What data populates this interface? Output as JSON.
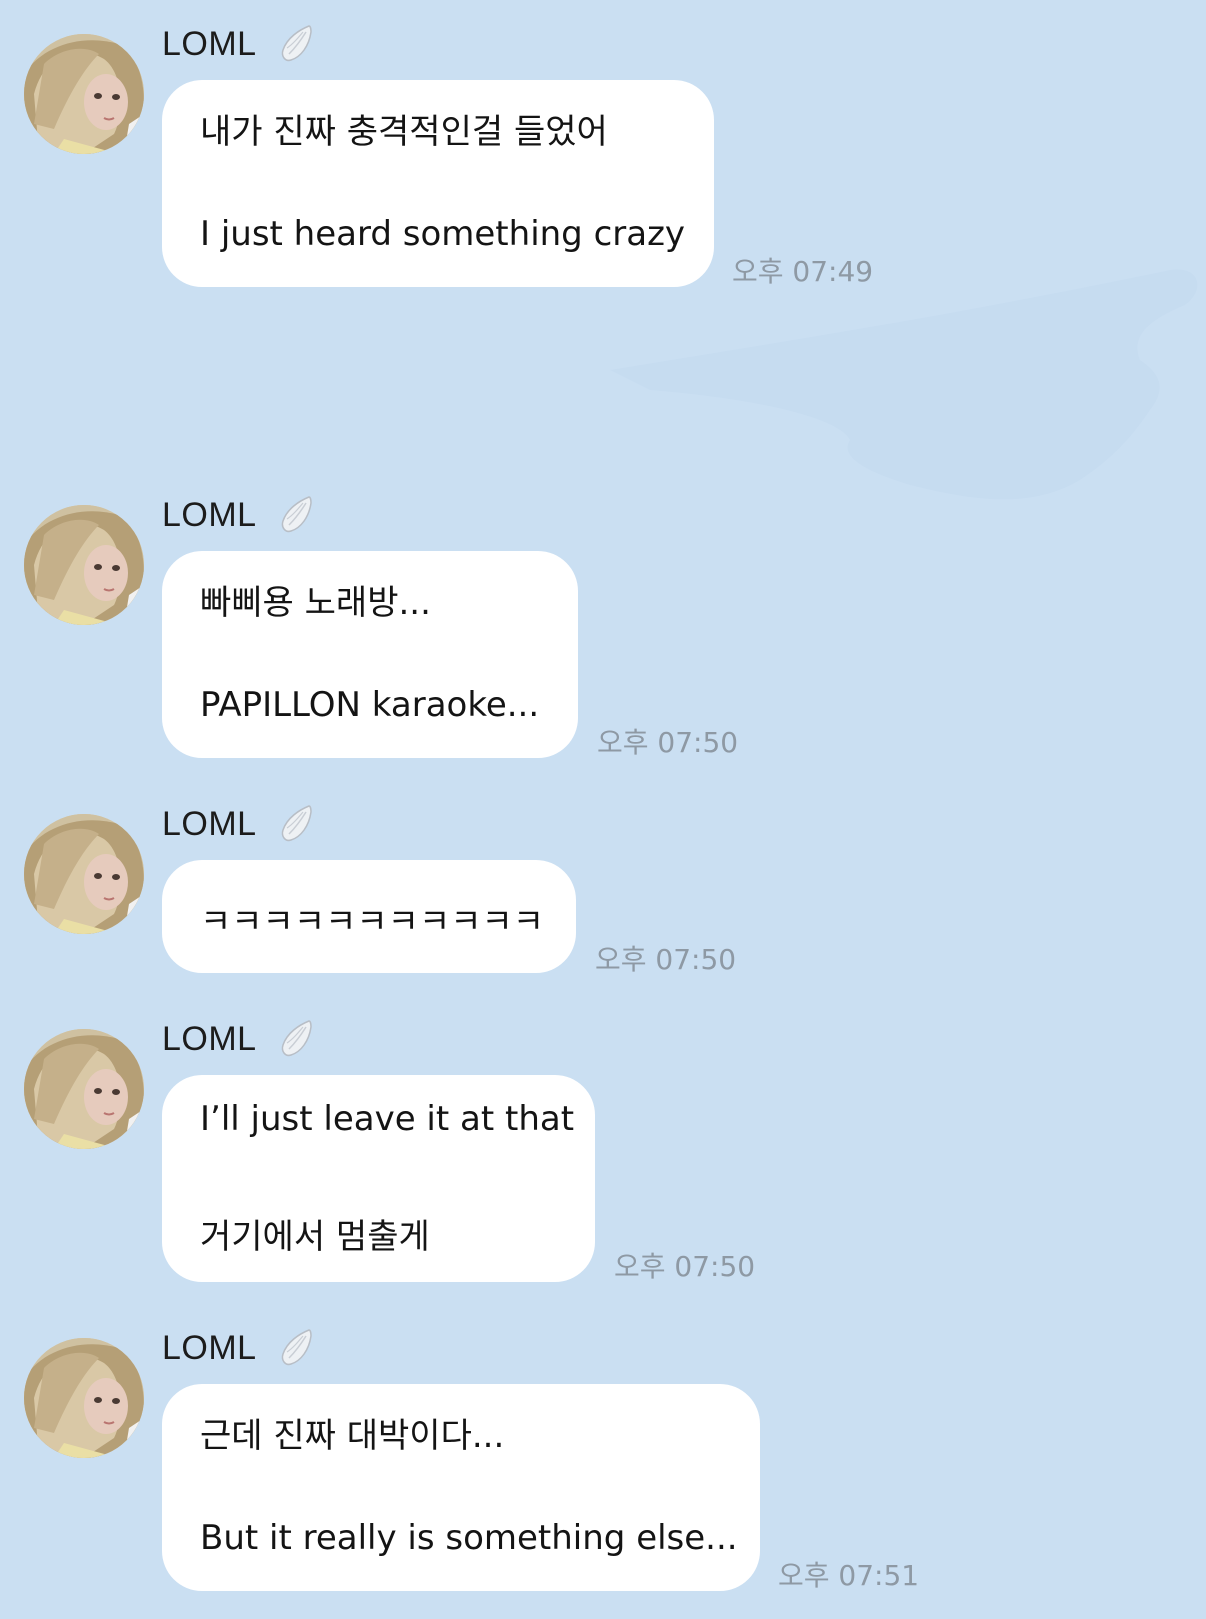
{
  "conversation": {
    "messages": [
      {
        "sender": "LOML",
        "sender_icon": "angel-wing-icon",
        "lines": [
          "내가 진짜 충격적인걸 들었어",
          "I just heard something crazy"
        ],
        "time": "오후 07:49"
      },
      {
        "sender": "LOML",
        "sender_icon": "angel-wing-icon",
        "lines": [
          "빠삐용 노래방...",
          "PAPILLON karaoke..."
        ],
        "time": "오후 07:50"
      },
      {
        "sender": "LOML",
        "sender_icon": "angel-wing-icon",
        "lines": [
          "ㅋㅋㅋㅋㅋㅋㅋㅋㅋㅋㅋ"
        ],
        "time": "오후 07:50"
      },
      {
        "sender": "LOML",
        "sender_icon": "angel-wing-icon",
        "lines": [
          "I’ll just leave it at that",
          "거기에서 멈출게"
        ],
        "time": "오후 07:50"
      },
      {
        "sender": "LOML",
        "sender_icon": "angel-wing-icon",
        "lines": [
          "근데 진짜 대박이다...",
          "But it really is something else..."
        ],
        "time": "오후 07:51"
      }
    ]
  },
  "colors": {
    "background": "#cadff2",
    "bubble": "#ffffff",
    "timestamp": "#8e99a4"
  }
}
